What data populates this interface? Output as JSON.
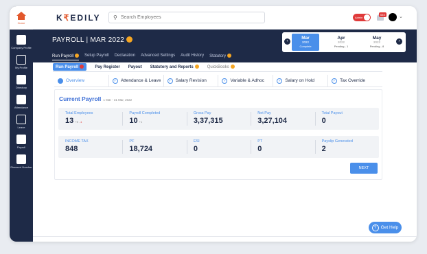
{
  "brand": {
    "name_pre": "K",
    "name_mark": "₹",
    "name_post": "EDILY",
    "accent": "#E2572B"
  },
  "search": {
    "placeholder": "Search Employees"
  },
  "topbar": {
    "admin_label": "Admin",
    "notification_count": "645"
  },
  "rail": {
    "home_label": "Home",
    "items": [
      {
        "label": "Company Profile"
      },
      {
        "label": "My Profile"
      },
      {
        "label": "Directory"
      },
      {
        "label": "Attendance"
      },
      {
        "label": "Leave"
      },
      {
        "label": "Payroll"
      },
      {
        "label": "Discount Voucher"
      }
    ]
  },
  "banner": {
    "title": "PAYROLL | MAR 2022",
    "nav": [
      "Run Payroll",
      "Setup Payroll",
      "Declaration",
      "Advanced Settings",
      "Audit History",
      "Statutory"
    ]
  },
  "months": [
    {
      "month": "Mar",
      "year": "2022",
      "status": "Complete"
    },
    {
      "month": "Apr",
      "year": "2022",
      "status": "Pending - 1"
    },
    {
      "month": "May",
      "year": "2022",
      "status": "Pending - 8"
    }
  ],
  "subtabs": [
    "Run Payroll",
    "Pay Register",
    "Payout",
    "Statutory and Reports",
    "QuickBooks"
  ],
  "steps": [
    "Overview",
    "Attendance & Leave",
    "Salary Revision",
    "Variable & Adhoc",
    "Salary on Hold",
    "Tax Override"
  ],
  "current_payroll": {
    "title": "Current Payroll",
    "period": "1 Mar - 31 Mar, 2022",
    "row1": [
      {
        "label": "Total Employees",
        "value": "13",
        "plus": "+5",
        "minus": "-1"
      },
      {
        "label": "Payroll Completed",
        "value": "10",
        "plus": "+1"
      },
      {
        "label": "Gross Pay",
        "value": "3,37,315"
      },
      {
        "label": "Net Pay",
        "value": "3,27,104"
      },
      {
        "label": "Total Payout",
        "value": "0"
      }
    ],
    "row2": [
      {
        "label": "INCOME TAX",
        "value": "848"
      },
      {
        "label": "PF",
        "value": "18,724"
      },
      {
        "label": "ESI",
        "value": "0"
      },
      {
        "label": "PT",
        "value": "0"
      },
      {
        "label": "Payslip Generated",
        "value": "2"
      }
    ],
    "next_label": "NEXT"
  },
  "help": {
    "label": "Get Help"
  }
}
